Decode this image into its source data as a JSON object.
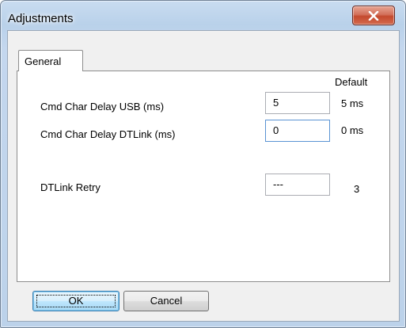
{
  "window": {
    "title": "Adjustments"
  },
  "icons": {
    "close": "close-icon"
  },
  "tabs": [
    {
      "label": "General",
      "selected": true
    }
  ],
  "general": {
    "default_header": "Default",
    "fields": [
      {
        "label": "Cmd Char Delay USB (ms)",
        "value": "5",
        "default": "5 ms"
      },
      {
        "label": "Cmd Char Delay DTLink (ms)",
        "value": "0",
        "default": "0 ms"
      },
      {
        "label": "DTLink Retry",
        "value": "---",
        "default": "3"
      }
    ]
  },
  "buttons": {
    "ok": "OK",
    "cancel": "Cancel"
  },
  "colors": {
    "close_button": "#c44a2e",
    "focus_border": "#5a93d3",
    "default_button_border": "#3c7fb1"
  }
}
